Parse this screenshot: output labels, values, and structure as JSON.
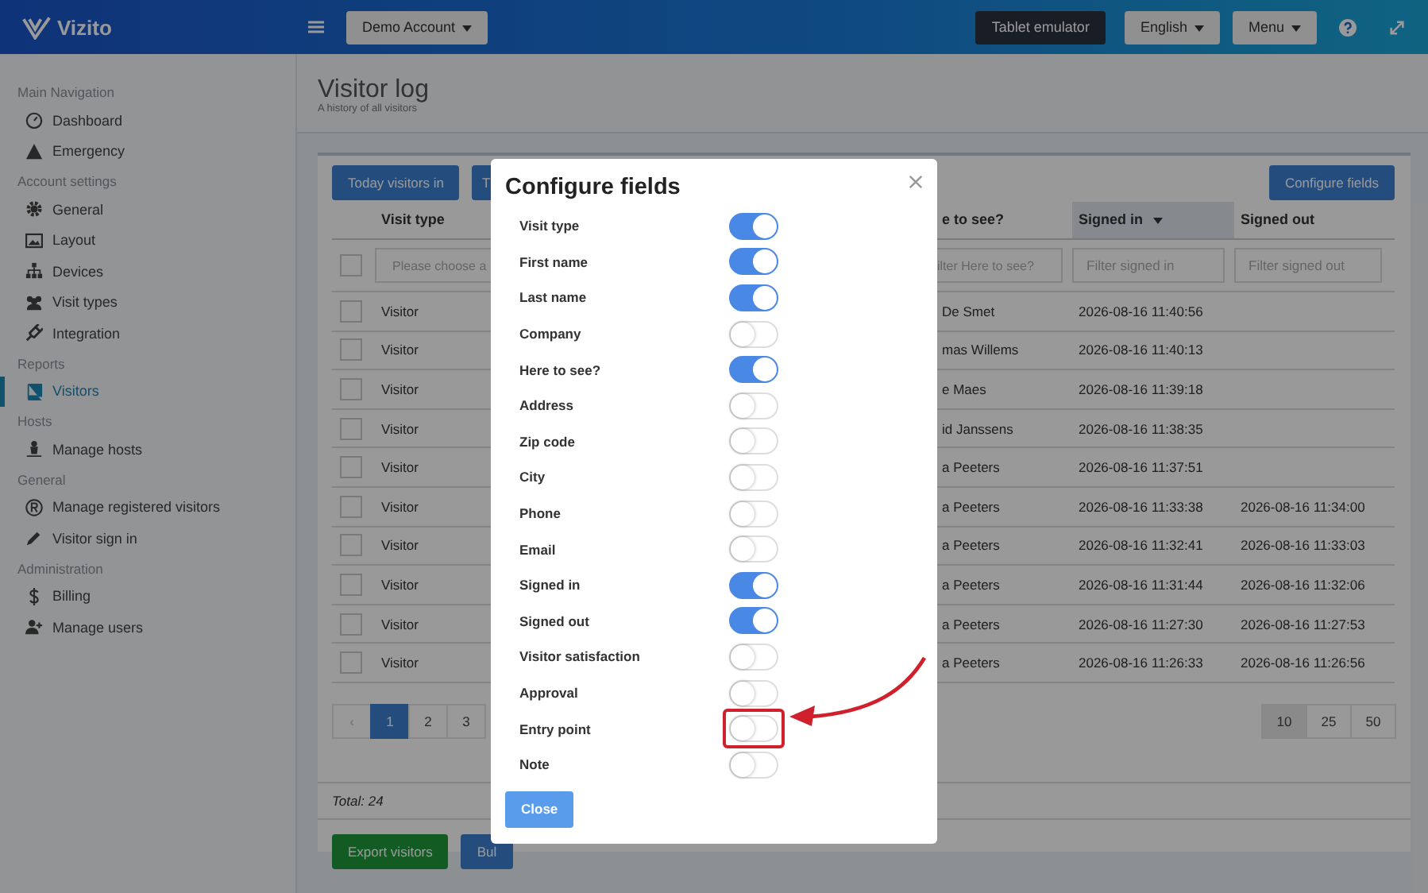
{
  "header": {
    "logo": "Vizito",
    "account": "Demo Account",
    "buttons": [
      {
        "label": "Tablet emulator",
        "kind": "dark"
      },
      {
        "label": "English",
        "kind": "dropdown"
      },
      {
        "label": "Menu",
        "kind": "dropdown"
      }
    ]
  },
  "sidebar": {
    "sections": [
      {
        "title": "Main Navigation",
        "items": [
          {
            "label": "Dashboard",
            "selected": false
          },
          {
            "label": "Emergency",
            "selected": false
          }
        ]
      },
      {
        "title": "Account settings",
        "items": [
          {
            "label": "General",
            "selected": false
          },
          {
            "label": "Layout",
            "selected": false
          },
          {
            "label": "Devices",
            "selected": false
          },
          {
            "label": "Visit types",
            "selected": false
          },
          {
            "label": "Integration",
            "selected": false
          }
        ]
      },
      {
        "title": "Reports",
        "items": [
          {
            "label": "Visitors",
            "selected": true
          }
        ]
      },
      {
        "title": "Hosts",
        "items": [
          {
            "label": "Manage hosts",
            "selected": false
          }
        ]
      },
      {
        "title": "General",
        "items": [
          {
            "label": "Manage registered visitors",
            "selected": false
          },
          {
            "label": "Visitor sign in",
            "selected": false
          }
        ]
      },
      {
        "title": "Administration",
        "items": [
          {
            "label": "Billing",
            "selected": false
          },
          {
            "label": "Manage users",
            "selected": false
          }
        ]
      }
    ]
  },
  "page": {
    "title": "Visitor log",
    "subtitle": "A history of all visitors"
  },
  "toolbar": {
    "buttons": [
      "Today visitors in",
      "T"
    ],
    "configure": "Configure fields"
  },
  "table": {
    "columns": [
      {
        "label": "Visit type",
        "sorted": false
      },
      {
        "label": "e to see?",
        "sorted": false
      },
      {
        "label": "Signed in",
        "sorted": true
      },
      {
        "label": "Signed out",
        "sorted": false
      }
    ],
    "select_all": {
      "checked": false
    },
    "filters": [
      {
        "placeholder": "Please choose a"
      },
      {
        "placeholder": "ilter Here to see?"
      },
      {
        "placeholder": "Filter signed in"
      },
      {
        "placeholder": "Filter signed out"
      }
    ],
    "rows": [
      {
        "checked": false,
        "type": "Visitor",
        "name": "De Smet",
        "signed_in": "2026-08-16 11:40:56"
      },
      {
        "checked": false,
        "type": "Visitor",
        "name": "mas Willems",
        "signed_in": "2026-08-16 11:40:13"
      },
      {
        "checked": false,
        "type": "Visitor",
        "name": "e Maes",
        "signed_in": "2026-08-16 11:39:18"
      },
      {
        "checked": false,
        "type": "Visitor",
        "name": "id Janssens",
        "signed_in": "2026-08-16 11:38:35"
      },
      {
        "checked": false,
        "type": "Visitor",
        "name": "a Peeters",
        "signed_in": "2026-08-16 11:37:51"
      },
      {
        "checked": false,
        "type": "Visitor",
        "name": "a Peeters",
        "signed_in": "2026-08-16 11:33:38",
        "signed_out": "2026-08-16 11:34:00"
      },
      {
        "checked": false,
        "type": "Visitor",
        "name": "a Peeters",
        "signed_in": "2026-08-16 11:32:41",
        "signed_out": "2026-08-16 11:33:03"
      },
      {
        "checked": false,
        "type": "Visitor",
        "name": "a Peeters",
        "signed_in": "2026-08-16 11:31:44",
        "signed_out": "2026-08-16 11:32:06"
      },
      {
        "checked": false,
        "type": "Visitor",
        "name": "a Peeters",
        "signed_in": "2026-08-16 11:27:30",
        "signed_out": "2026-08-16 11:27:53"
      },
      {
        "checked": false,
        "type": "Visitor",
        "name": "a Peeters",
        "signed_in": "2026-08-16 11:26:33",
        "signed_out": "2026-08-16 11:26:56"
      }
    ]
  },
  "pagination": {
    "prev": "‹",
    "pages": [
      {
        "label": "1",
        "selected": true
      },
      {
        "label": "2",
        "selected": false
      },
      {
        "label": "3",
        "selected": false
      }
    ],
    "page_sizes": [
      {
        "label": "10",
        "selected": true
      },
      {
        "label": "25",
        "selected": false
      },
      {
        "label": "50",
        "selected": false
      }
    ]
  },
  "total": "Total: 24",
  "footer_buttons": [
    {
      "label": "Export visitors",
      "kind": "success"
    },
    {
      "label": "Bul",
      "kind": "primary"
    }
  ],
  "modal": {
    "title": "Configure fields",
    "close": "Close",
    "fields": [
      {
        "label": "Visit type",
        "on": true,
        "highlighted": false
      },
      {
        "label": "First name",
        "on": true,
        "highlighted": false
      },
      {
        "label": "Last name",
        "on": true,
        "highlighted": false
      },
      {
        "label": "Company",
        "on": false,
        "highlighted": false
      },
      {
        "label": "Here to see?",
        "on": true,
        "highlighted": false
      },
      {
        "label": "Address",
        "on": false,
        "highlighted": false
      },
      {
        "label": "Zip code",
        "on": false,
        "highlighted": false
      },
      {
        "label": "City",
        "on": false,
        "highlighted": false
      },
      {
        "label": "Phone",
        "on": false,
        "highlighted": false
      },
      {
        "label": "Email",
        "on": false,
        "highlighted": false
      },
      {
        "label": "Signed in",
        "on": true,
        "highlighted": false
      },
      {
        "label": "Signed out",
        "on": true,
        "highlighted": false
      },
      {
        "label": "Visitor satisfaction",
        "on": false,
        "highlighted": false
      },
      {
        "label": "Approval",
        "on": false,
        "highlighted": false
      },
      {
        "label": "Entry point",
        "on": false,
        "highlighted": true
      },
      {
        "label": "Note",
        "on": false,
        "highlighted": false
      }
    ]
  }
}
